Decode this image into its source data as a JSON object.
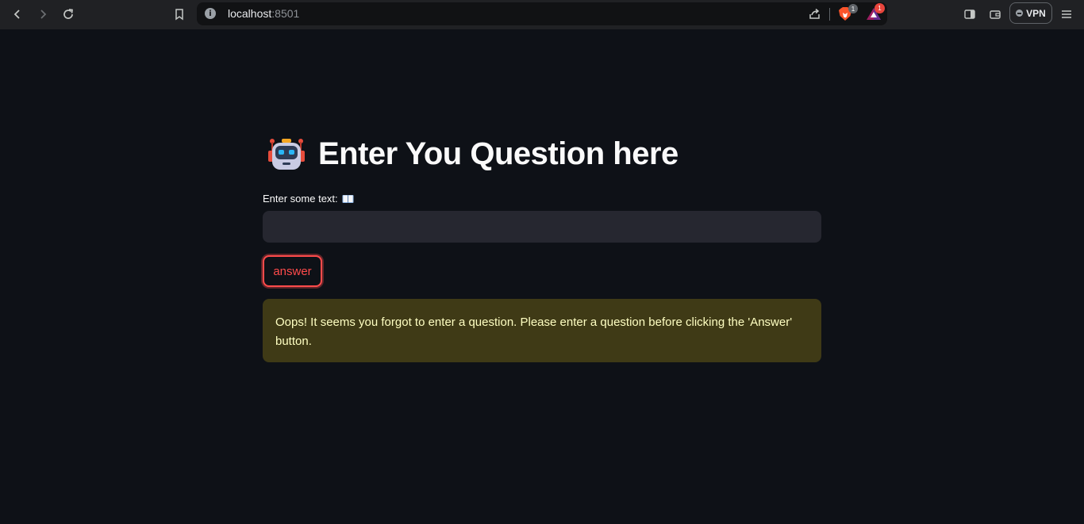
{
  "browser": {
    "url_host": "localhost",
    "url_port": ":8501",
    "brave_badge_count": "1",
    "rewards_badge_count": "1",
    "vpn_label": "VPN"
  },
  "app": {
    "title": "Enter You Question here",
    "input_label": "Enter some text:",
    "input_value": "",
    "button_label": "answer",
    "warning_text": "Oops! It seems you forgot to enter a question. Please enter a question before clicking the 'Answer' button."
  },
  "colors": {
    "background": "#0e1117",
    "accent": "#ff4b4b",
    "warning_bg": "#3f3a16",
    "warning_text": "#ffffc2"
  }
}
